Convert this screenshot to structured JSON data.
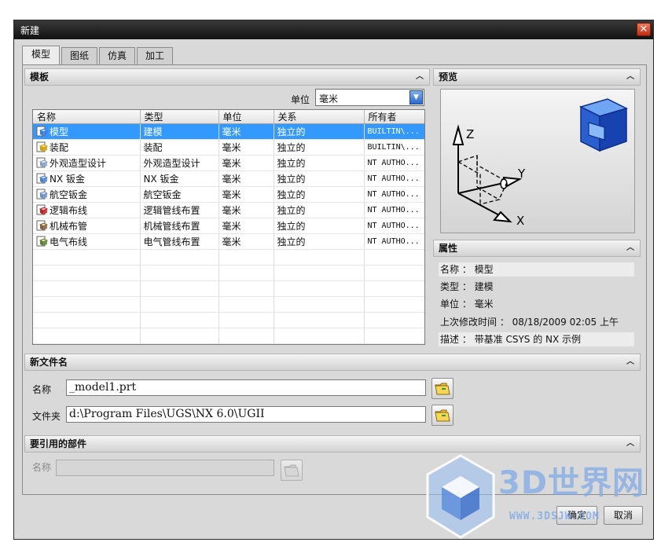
{
  "window": {
    "title": "新建",
    "close_glyph": "✕"
  },
  "tabs": [
    {
      "label": "模型",
      "active": true
    },
    {
      "label": "图纸",
      "active": false
    },
    {
      "label": "仿真",
      "active": false
    },
    {
      "label": "加工",
      "active": false
    }
  ],
  "template_section": {
    "title": "模板",
    "unit_label": "单位",
    "unit_value": "毫米",
    "columns": [
      "名称",
      "类型",
      "单位",
      "关系",
      "所有者"
    ],
    "rows": [
      {
        "icon": "model-icon",
        "name": "模型",
        "type": "建模",
        "unit": "毫米",
        "relation": "独立的",
        "owner": "BUILTIN\\...",
        "selected": true
      },
      {
        "icon": "assembly-icon",
        "name": "装配",
        "type": "装配",
        "unit": "毫米",
        "relation": "独立的",
        "owner": "BUILTIN\\..."
      },
      {
        "icon": "shape-design-icon",
        "name": "外观造型设计",
        "type": "外观造型设计",
        "unit": "毫米",
        "relation": "独立的",
        "owner": "NT AUTHO..."
      },
      {
        "icon": "sheet-metal-icon",
        "name": "NX 钣金",
        "type": "NX 钣金",
        "unit": "毫米",
        "relation": "独立的",
        "owner": "NT AUTHO..."
      },
      {
        "icon": "aero-sheet-metal-icon",
        "name": "航空钣金",
        "type": "航空钣金",
        "unit": "毫米",
        "relation": "独立的",
        "owner": "NT AUTHO..."
      },
      {
        "icon": "logical-routing-icon",
        "name": "逻辑布线",
        "type": "逻辑管线布置",
        "unit": "毫米",
        "relation": "独立的",
        "owner": "NT AUTHO..."
      },
      {
        "icon": "mechanical-routing-icon",
        "name": "机械布管",
        "type": "机械管线布置",
        "unit": "毫米",
        "relation": "独立的",
        "owner": "NT AUTHO..."
      },
      {
        "icon": "electrical-routing-icon",
        "name": "电气布线",
        "type": "电气管线布置",
        "unit": "毫米",
        "relation": "独立的",
        "owner": "NT AUTHO..."
      }
    ],
    "empty_rows": 6
  },
  "preview_section": {
    "title": "预览",
    "axis_x": "X",
    "axis_y": "Y",
    "axis_z": "Z",
    "cube_icon": "model-cube-icon"
  },
  "properties_section": {
    "title": "属性",
    "items": [
      {
        "text": "名称 ： 模型"
      },
      {
        "text": "类型 ： 建模"
      },
      {
        "text": "单位 ： 毫米"
      },
      {
        "text": "上次修改时间 ： 08/18/2009 02:05 上午"
      },
      {
        "text": "描述 ： 带基准 CSYS 的 NX 示例"
      }
    ]
  },
  "new_filename_section": {
    "title": "新文件名",
    "name_label": "名称",
    "name_value": "_model1.prt",
    "folder_label": "文件夹",
    "folder_value": "d:\\Program Files\\UGS\\NX 6.0\\UGII"
  },
  "referenced_part_section": {
    "title": "要引用的部件",
    "name_label": "名称",
    "name_value": ""
  },
  "buttons": {
    "ok_label": "确定",
    "cancel_label": "取消"
  },
  "watermark": {
    "text": "3D世界网",
    "url": "WWW.3DSJW.COM"
  },
  "colors": {
    "selection": "#3399ff",
    "title_bar": "#1a1a1a",
    "close_button": "#d8401c"
  }
}
